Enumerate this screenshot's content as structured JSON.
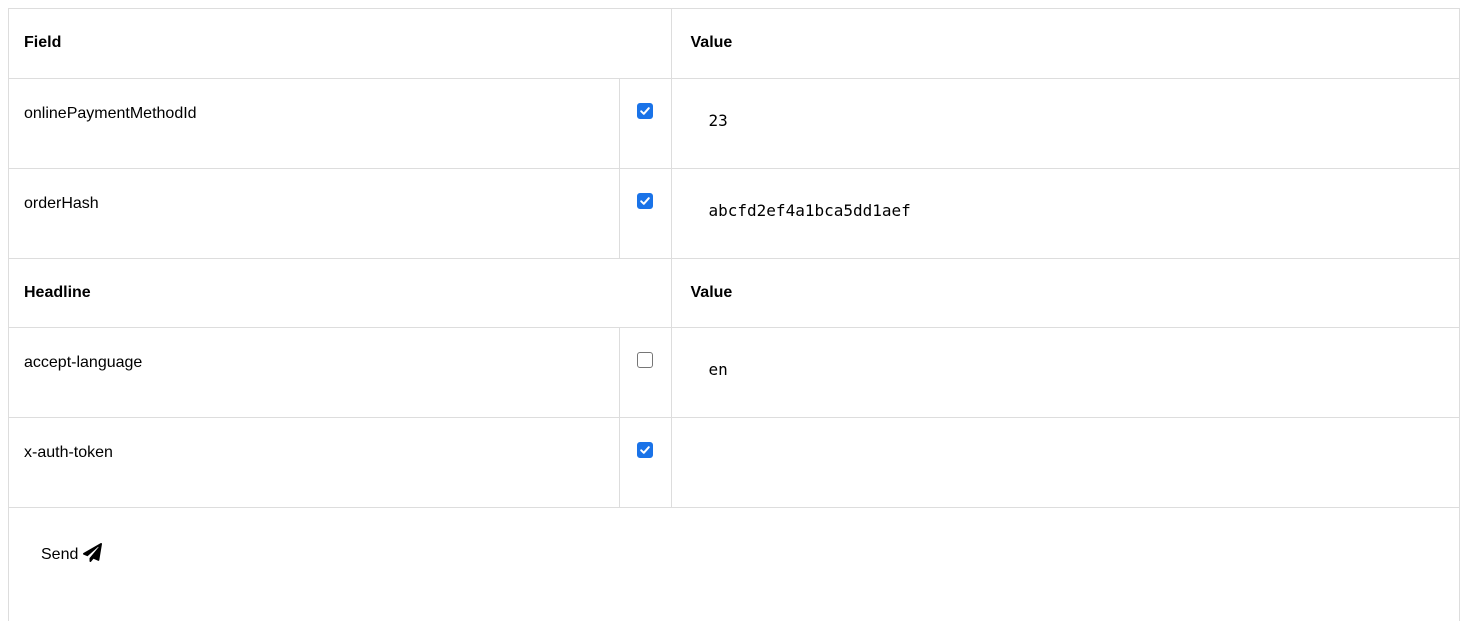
{
  "fields_section": {
    "header": {
      "name": "Field",
      "value": "Value"
    },
    "rows": [
      {
        "name": "onlinePaymentMethodId",
        "checked": true,
        "value": "23"
      },
      {
        "name": "orderHash",
        "checked": true,
        "value": "abcfd2ef4a1bca5dd1aef"
      }
    ]
  },
  "headers_section": {
    "header": {
      "name": "Headline",
      "value": "Value"
    },
    "rows": [
      {
        "name": "accept-language",
        "checked": false,
        "value": "en"
      },
      {
        "name": "x-auth-token",
        "checked": true,
        "value": ""
      }
    ]
  },
  "send": {
    "label": "Send",
    "icon": "paper-plane-icon"
  },
  "colors": {
    "checkbox_checked": "#1a73e8",
    "border": "#dddddd"
  }
}
